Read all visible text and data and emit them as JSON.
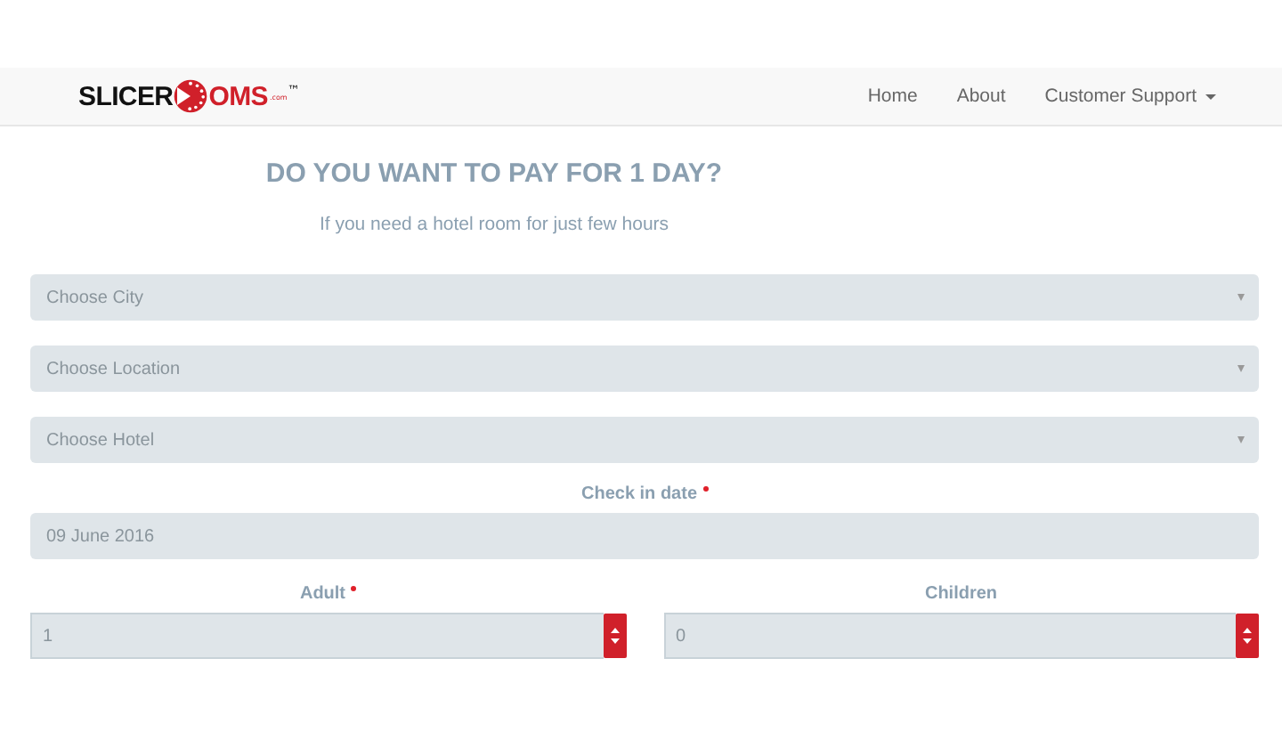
{
  "logo": {
    "left": "SLICER",
    "right": "OMS",
    "suffix": ".com",
    "mark": "™"
  },
  "nav": [
    {
      "label": "Home",
      "dropdown": false
    },
    {
      "label": "About",
      "dropdown": false
    },
    {
      "label": "Customer Support",
      "dropdown": true
    }
  ],
  "hero": {
    "title": "DO YOU WANT TO PAY FOR 1 DAY?",
    "subtitle": "If you need a hotel room for just few hours"
  },
  "selects": [
    {
      "placeholder": "Choose City"
    },
    {
      "placeholder": "Choose Location"
    },
    {
      "placeholder": "Choose Hotel"
    }
  ],
  "checkin": {
    "label": "Check in date",
    "required": true,
    "value": "09 June 2016"
  },
  "counters": [
    {
      "label": "Adult",
      "required": true,
      "value": "1"
    },
    {
      "label": "Children",
      "required": false,
      "value": "0"
    }
  ]
}
